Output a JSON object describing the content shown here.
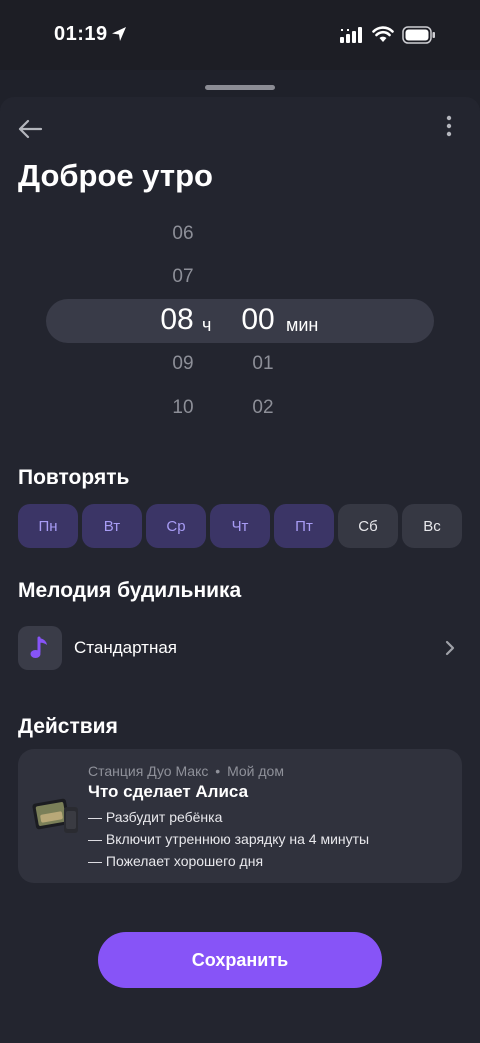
{
  "status_bar": {
    "time": "01:19"
  },
  "header": {
    "title": "Доброе утро"
  },
  "time_picker": {
    "hours_above": [
      "06",
      "07"
    ],
    "hour_selected": "08",
    "hours_below": [
      "09",
      "10"
    ],
    "hour_unit": "ч",
    "minute_selected": "00",
    "minutes_below": [
      "01",
      "02"
    ],
    "minute_unit": "мин"
  },
  "repeat": {
    "title": "Повторять",
    "days": [
      {
        "label": "Пн",
        "selected": true
      },
      {
        "label": "Вт",
        "selected": true
      },
      {
        "label": "Ср",
        "selected": true
      },
      {
        "label": "Чт",
        "selected": true
      },
      {
        "label": "Пт",
        "selected": true
      },
      {
        "label": "Сб",
        "selected": false
      },
      {
        "label": "Вс",
        "selected": false
      }
    ]
  },
  "melody": {
    "title": "Мелодия будильника",
    "value": "Стандартная"
  },
  "actions": {
    "title": "Действия",
    "card": {
      "device": "Станция Дуо Макс",
      "separator": "•",
      "home": "Мой дом",
      "heading": "Что сделает Алиса",
      "lines": [
        "— Разбудит ребёнка",
        "— Включит утреннюю зарядку на 4 минуты",
        "— Пожелает хорошего дня"
      ]
    }
  },
  "save_button": {
    "label": "Сохранить"
  },
  "colors": {
    "accent": "#8754f7",
    "day_selected_bg": "#3b3566",
    "day_selected_text": "#a89cf5",
    "background": "#23252f"
  }
}
